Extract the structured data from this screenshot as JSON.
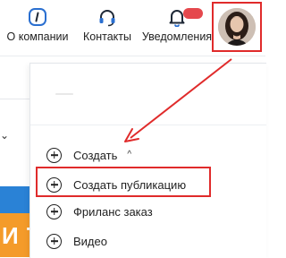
{
  "header": {
    "nav": [
      {
        "label": "О компании",
        "icon": "info-icon"
      },
      {
        "label": "Контакты",
        "icon": "headset-icon"
      },
      {
        "label": "Уведомления",
        "icon": "bell-icon"
      }
    ],
    "avatar_icon": "user-avatar"
  },
  "background": {
    "partial_text": "И Т"
  },
  "dropdown": {
    "create_label": "Создать",
    "items": [
      {
        "label": "Создать публикацию",
        "icon": "plus-circle-icon"
      },
      {
        "label": "Фриланс заказ",
        "icon": "plus-circle-icon"
      },
      {
        "label": "Видео",
        "icon": "plus-circle-icon"
      }
    ]
  },
  "colors": {
    "accent_blue": "#2a82d6",
    "annotation_red": "#e02b2b",
    "orange_banner": "#f49b2a"
  }
}
